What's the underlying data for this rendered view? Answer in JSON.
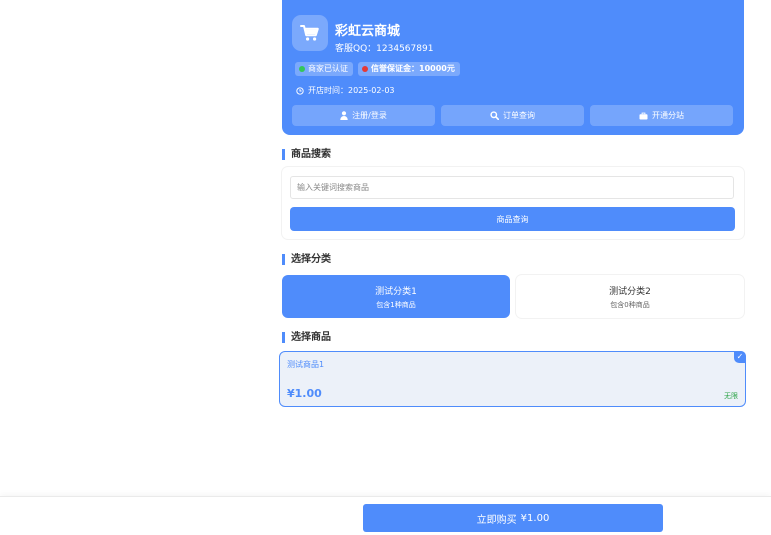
{
  "shop": {
    "name": "彩虹云商城",
    "qq_label": "客服QQ：",
    "qq": "1234567891",
    "badges": {
      "verified": "商家已认证",
      "deposit": "信誉保证金：10000元"
    },
    "open_time_label": "开店时间：",
    "open_time": "2025-02-03",
    "actions": [
      {
        "label": "注册/登录",
        "icon": "user-icon"
      },
      {
        "label": "订单查询",
        "icon": "search-icon"
      },
      {
        "label": "开通分站",
        "icon": "briefcase-icon"
      }
    ]
  },
  "search": {
    "title": "商品搜索",
    "placeholder": "输入关键词搜索商品",
    "value": "",
    "button": "商品查询"
  },
  "category": {
    "title": "选择分类",
    "items": [
      {
        "name": "测试分类1",
        "sub": "包含1种商品",
        "selected": true
      },
      {
        "name": "测试分类2",
        "sub": "包含0种商品",
        "selected": false
      }
    ]
  },
  "products": {
    "title": "选择商品",
    "items": [
      {
        "name": "测试商品1",
        "price": "¥1.00",
        "stock": "无限",
        "selected": true
      }
    ]
  },
  "footer": {
    "buy_label": "立即购买",
    "total": "¥1.00"
  },
  "colors": {
    "accent": "#4f8cfb",
    "stock": "#2fa54a",
    "verified_dot": "#34c759",
    "deposit_dot": "#e53935"
  }
}
